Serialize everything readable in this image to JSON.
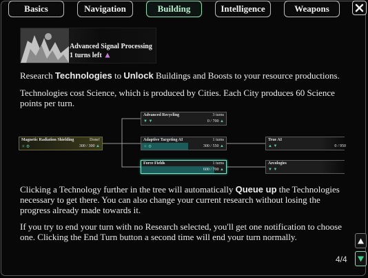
{
  "tabs": [
    {
      "label": "Basics"
    },
    {
      "label": "Navigation"
    },
    {
      "label": "Building"
    },
    {
      "label": "Intelligence"
    },
    {
      "label": "Weapons"
    }
  ],
  "close_icon": "close-icon",
  "banner": {
    "title": "Advanced Signal Processing",
    "turns": "1 turns left"
  },
  "para1": {
    "t1": "Research ",
    "b1": "Technologies",
    "t2": " to ",
    "b2": "Unlock",
    "t3": " Buildings and Boosts to your resource productions."
  },
  "para2": "Technologies cost Science, which is produced by Cities. Each City produces 60 Science points per turn.",
  "tree": {
    "nodes": [
      {
        "name": "Magnetic Radiation Shielding",
        "turns": "Done!",
        "progress": "300 / 300"
      },
      {
        "name": "Advanced Recycling",
        "turns": "3 turns",
        "progress": "0 / 700"
      },
      {
        "name": "Adaptive Targeting AI",
        "turns": "1 turns",
        "progress": "300 / 550"
      },
      {
        "name": "Force Fields",
        "turns": "1 turns",
        "progress": "600 / 700"
      },
      {
        "name": "True AI",
        "turns": "",
        "progress": "0 / 950"
      },
      {
        "name": "Arcologies",
        "turns": "",
        "progress": ""
      }
    ]
  },
  "para3": {
    "t1": "Clicking a Technology further in the tree will automatically ",
    "b1": "Queue up",
    "t2": " the Technologies necessary to get there. You can also change your current research without losing the progress already made towards it."
  },
  "para4": "If you try to end your turn with no Research selected, you'll get one notification to choose one. Clicking  the End Turn button a second time will end your turn normally.",
  "pager": "4/4",
  "colors": {
    "accent": "#8ee0b6",
    "progress": "#1b5b5a"
  }
}
